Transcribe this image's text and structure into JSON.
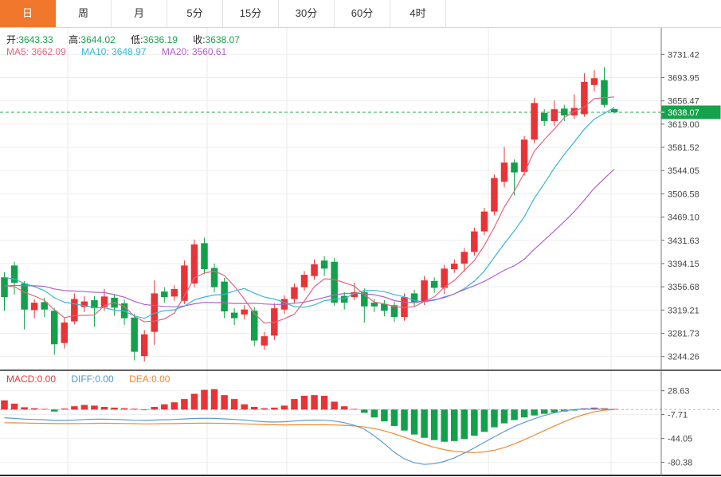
{
  "tabs": [
    {
      "label": "日",
      "active": true
    },
    {
      "label": "周",
      "active": false
    },
    {
      "label": "月",
      "active": false
    },
    {
      "label": "5分",
      "active": false
    },
    {
      "label": "15分",
      "active": false
    },
    {
      "label": "30分",
      "active": false
    },
    {
      "label": "60分",
      "active": false
    },
    {
      "label": "4时",
      "active": false
    }
  ],
  "ohlc_legend": [
    {
      "label": "开:",
      "value": "3643.33"
    },
    {
      "label": "高:",
      "value": "3644.02"
    },
    {
      "label": "低:",
      "value": "3636.19"
    },
    {
      "label": "收:",
      "value": "3638.07"
    }
  ],
  "ma_legend": [
    {
      "label": "MA5:",
      "value": "3662.09",
      "color": "#e8647f"
    },
    {
      "label": "MA10:",
      "value": "3648.97",
      "color": "#35b8d2"
    },
    {
      "label": "MA20:",
      "value": "3560.61",
      "color": "#b161cb"
    }
  ],
  "macd_legend": [
    {
      "label": "MACD:",
      "value": "0.00",
      "color": "#e23b3b"
    },
    {
      "label": "DIFF:",
      "value": "0.00",
      "color": "#4f94d6"
    },
    {
      "label": "DEA:",
      "value": "0.00",
      "color": "#ef8833"
    }
  ],
  "colors": {
    "up": "#e83437",
    "down": "#12a14b",
    "ma5": "#e8647f",
    "ma10": "#35b8d2",
    "ma20": "#b161cb",
    "diff_line": "#5b9bd5",
    "dea_line": "#ef8833",
    "price_dash": "#28a74e",
    "zero_dash": "#9fc8c4",
    "grid": "#ededed",
    "axis_text": "#444",
    "tag_bg": "#16a24c",
    "tab_active_bg": "#f0772c"
  },
  "chart_data": {
    "type": "candlestick",
    "title": "",
    "current_price": "3638.07",
    "price_ticks": [
      "3731.42",
      "3693.95",
      "3656.47",
      "3619.00",
      "3581.52",
      "3544.05",
      "3506.58",
      "3469.10",
      "3431.63",
      "3394.15",
      "3356.68",
      "3319.21",
      "3281.73",
      "3244.26"
    ],
    "macd_ticks": [
      "28.63",
      "-7.71",
      "-44.05",
      "-80.38"
    ],
    "ylim_main": [
      3225,
      3755
    ],
    "ylim_macd": [
      -95,
      40
    ],
    "grid": true,
    "legend_position": "top-left",
    "vgrid_x": [
      85,
      260,
      360,
      613,
      767
    ],
    "candles": [
      [
        3372,
        3380,
        3318,
        3340
      ],
      [
        3391,
        3397,
        3344,
        3363
      ],
      [
        3362,
        3366,
        3288,
        3320
      ],
      [
        3319,
        3337,
        3306,
        3331
      ],
      [
        3332,
        3339,
        3308,
        3320
      ],
      [
        3318,
        3322,
        3247,
        3264
      ],
      [
        3266,
        3306,
        3257,
        3299
      ],
      [
        3301,
        3346,
        3296,
        3337
      ],
      [
        3324,
        3342,
        3316,
        3333
      ],
      [
        3335,
        3342,
        3292,
        3322
      ],
      [
        3324,
        3353,
        3318,
        3341
      ],
      [
        3339,
        3345,
        3310,
        3323
      ],
      [
        3330,
        3336,
        3295,
        3306
      ],
      [
        3307,
        3313,
        3238,
        3252
      ],
      [
        3245,
        3287,
        3236,
        3280
      ],
      [
        3284,
        3367,
        3263,
        3346
      ],
      [
        3349,
        3356,
        3331,
        3340
      ],
      [
        3341,
        3359,
        3334,
        3353
      ],
      [
        3334,
        3399,
        3329,
        3391
      ],
      [
        3362,
        3433,
        3356,
        3425
      ],
      [
        3427,
        3436,
        3377,
        3385
      ],
      [
        3387,
        3394,
        3348,
        3356
      ],
      [
        3365,
        3371,
        3306,
        3317
      ],
      [
        3315,
        3322,
        3295,
        3306
      ],
      [
        3312,
        3327,
        3304,
        3320
      ],
      [
        3318,
        3324,
        3261,
        3270
      ],
      [
        3262,
        3284,
        3255,
        3277
      ],
      [
        3278,
        3330,
        3271,
        3322
      ],
      [
        3320,
        3343,
        3313,
        3337
      ],
      [
        3337,
        3362,
        3330,
        3356
      ],
      [
        3356,
        3382,
        3350,
        3376
      ],
      [
        3374,
        3401,
        3368,
        3393
      ],
      [
        3399,
        3406,
        3374,
        3386
      ],
      [
        3397,
        3403,
        3326,
        3331
      ],
      [
        3342,
        3348,
        3320,
        3331
      ],
      [
        3340,
        3363,
        3335,
        3348
      ],
      [
        3348,
        3354,
        3299,
        3325
      ],
      [
        3331,
        3337,
        3316,
        3325
      ],
      [
        3329,
        3335,
        3309,
        3318
      ],
      [
        3327,
        3332,
        3300,
        3308
      ],
      [
        3308,
        3346,
        3302,
        3340
      ],
      [
        3346,
        3352,
        3325,
        3332
      ],
      [
        3332,
        3374,
        3327,
        3367
      ],
      [
        3366,
        3372,
        3347,
        3355
      ],
      [
        3355,
        3392,
        3345,
        3386
      ],
      [
        3385,
        3401,
        3379,
        3394
      ],
      [
        3394,
        3419,
        3381,
        3413
      ],
      [
        3413,
        3452,
        3407,
        3446
      ],
      [
        3446,
        3484,
        3440,
        3478
      ],
      [
        3478,
        3538,
        3472,
        3532
      ],
      [
        3526,
        3582,
        3517,
        3557
      ],
      [
        3557,
        3562,
        3504,
        3541
      ],
      [
        3542,
        3600,
        3536,
        3594
      ],
      [
        3594,
        3661,
        3588,
        3653
      ],
      [
        3637,
        3643,
        3616,
        3624
      ],
      [
        3624,
        3657,
        3616,
        3643
      ],
      [
        3644,
        3650,
        3624,
        3633
      ],
      [
        3633,
        3667,
        3627,
        3645
      ],
      [
        3635,
        3701,
        3631,
        3687
      ],
      [
        3682,
        3706,
        3672,
        3693
      ],
      [
        3690,
        3711,
        3646,
        3650
      ],
      [
        3643.33,
        3644.02,
        3636.19,
        3638.07
      ]
    ],
    "seed_closes": [
      3340,
      3335,
      3330,
      3340,
      3345,
      3350,
      3355,
      3350,
      3345,
      3350,
      3390,
      3388,
      3385,
      3382,
      3380,
      3370,
      3365,
      3362,
      3355
    ],
    "macd": {
      "hist": [
        14,
        9,
        3.5,
        2,
        0.5,
        -3,
        1.5,
        5,
        7,
        6,
        4,
        3,
        2,
        1.2,
        -1,
        4,
        8,
        11,
        16,
        24,
        30,
        31,
        22,
        16,
        8,
        4,
        2,
        3,
        6,
        16,
        21,
        22,
        21,
        12,
        5,
        0.5,
        -5,
        -12,
        -18,
        -25,
        -32,
        -38,
        -43,
        -46.5,
        -49,
        -48,
        -45,
        -40,
        -34,
        -27,
        -21,
        -16,
        -12,
        -9,
        -6.5,
        -4.5,
        -3,
        -1.5,
        2,
        3,
        2,
        0.5
      ],
      "diff": [
        -12.5,
        -13.5,
        -14.5,
        -15,
        -15.5,
        -16.5,
        -16.5,
        -16,
        -15.2,
        -14.8,
        -14.5,
        -15,
        -15.5,
        -16.2,
        -16.5,
        -16,
        -15.5,
        -15,
        -14.3,
        -13.6,
        -13.2,
        -13.5,
        -14.2,
        -15,
        -16,
        -17.5,
        -18.5,
        -19,
        -18.5,
        -17.5,
        -16.5,
        -16,
        -16.2,
        -17.5,
        -20,
        -24,
        -30,
        -40,
        -52,
        -65,
        -75,
        -81,
        -83.5,
        -82.5,
        -79,
        -73.5,
        -66.5,
        -58.5,
        -50,
        -41.5,
        -33.5,
        -26,
        -19.5,
        -14,
        -9,
        -5,
        -2,
        0,
        1,
        1,
        0.5,
        0
      ],
      "dea": [
        -20,
        -20.2,
        -20.5,
        -20.8,
        -21,
        -21.3,
        -21.5,
        -21.4,
        -21.2,
        -21,
        -20.9,
        -21,
        -21.2,
        -21.5,
        -21.8,
        -21.7,
        -21.5,
        -21.3,
        -21,
        -20.8,
        -20.7,
        -20.8,
        -21,
        -21.4,
        -21.8,
        -22.3,
        -22.8,
        -23.2,
        -23.4,
        -23.3,
        -23.2,
        -23.1,
        -23.2,
        -23.5,
        -24,
        -25,
        -26.5,
        -29,
        -32.5,
        -37,
        -42,
        -47.5,
        -53,
        -57.5,
        -61,
        -63.5,
        -65,
        -65.5,
        -64.5,
        -62,
        -58,
        -52.5,
        -46,
        -39,
        -32,
        -25,
        -18.5,
        -12.5,
        -7.5,
        -3.5,
        -1,
        0
      ]
    }
  }
}
